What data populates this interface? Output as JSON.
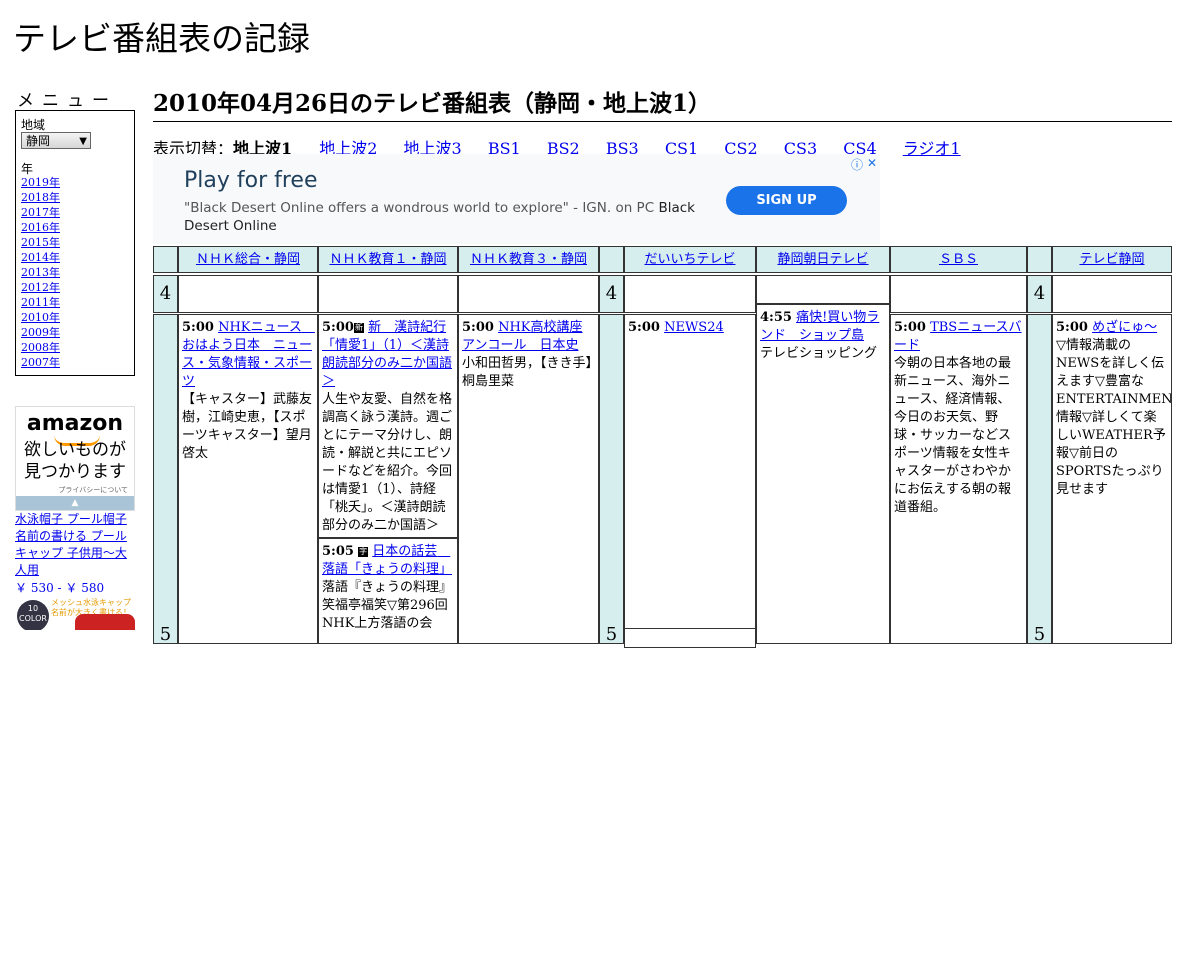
{
  "site_title": "テレビ番組表の記録",
  "menu": {
    "heading": "メニュー",
    "region_label": "地域",
    "region_value": "静岡",
    "year_label": "年",
    "years": [
      "2019年",
      "2018年",
      "2017年",
      "2016年",
      "2015年",
      "2014年",
      "2013年",
      "2012年",
      "2011年",
      "2010年",
      "2009年",
      "2008年",
      "2007年"
    ]
  },
  "amazon_ad": {
    "logo": "amazon",
    "copy_line1": "欲しいものが",
    "copy_line2": "見つかります",
    "privacy": "プライバシーについて"
  },
  "product": {
    "name": "水泳帽子 プール帽子 名前の書ける プールキャップ 子供用～大人用",
    "price": "￥ 530 - ￥ 580",
    "badge": "10 COLOR",
    "tagline": "メッシュ水泳キャップ 名前が大きく書ける！"
  },
  "page_heading": "2010年04月26日のテレビ番組表（静岡・地上波1）",
  "switcher": {
    "label": "表示切替：",
    "current": "地上波1",
    "links": [
      "地上波2",
      "地上波3",
      "BS1",
      "BS2",
      "BS3",
      "CS1",
      "CS2",
      "CS3",
      "CS4",
      "ラジオ1"
    ]
  },
  "ad_banner": {
    "headline": "Play for free",
    "description": "\"Black Desert Online offers a wondrous world to explore\" - IGN. on PC",
    "advertiser": "Black Desert Online",
    "button": "SIGN UP"
  },
  "schedule": {
    "channels": [
      "ＮＨＫ総合・静岡",
      "ＮＨＫ教育１・静岡",
      "ＮＨＫ教育３・静岡",
      "だいいちテレビ",
      "静岡朝日テレビ",
      "ＳＢＳ",
      "テレビ静岡"
    ],
    "hours": [
      "4",
      "5"
    ],
    "programs": {
      "nhk_sogo": {
        "time": "5:00",
        "title": "NHKニュース　おはよう日本　ニュース・気象情報・スポーツ",
        "desc": "【キャスター】武藤友樹，江崎史恵，【スポーツキャスター】望月啓太"
      },
      "nhk_edu1_a": {
        "time": "5:00",
        "mark": "新",
        "title": "新　漢詩紀行「情愛1」（1）＜漢詩朗読部分のみ二か国語＞",
        "desc": "人生や友愛、自然を格調高く詠う漢詩。週ごとにテーマ分けし、朗読・解説と共にエピソードなどを紹介。今回は情愛1（1）、詩経「桃夭」。＜漢詩朗読部分のみ二か国語＞"
      },
      "nhk_edu1_b": {
        "time": "5:05",
        "mark": "字",
        "title": "日本の話芸　落語「きょうの料理」",
        "desc": "落語『きょうの料理』笑福亭福笑▽第296回NHK上方落語の会"
      },
      "nhk_edu3": {
        "time": "5:00",
        "title": "NHK高校講座アンコール　日本史",
        "desc": "小和田哲男，【きき手】桐島里菜"
      },
      "daiichi": {
        "time": "5:00",
        "title": "NEWS24",
        "desc": ""
      },
      "asahi": {
        "time": "4:55",
        "title": "痛快!買い物ランド　ショップ島",
        "desc": "テレビショッピング"
      },
      "sbs": {
        "time": "5:00",
        "title": "TBSニュースバード",
        "desc": "今朝の日本各地の最新ニュース、海外ニュース、経済情報、今日のお天気、野球・サッカーなどスポーツ情報を女性キャスターがさわやかにお伝えする朝の報道番組。"
      },
      "tvshizuoka": {
        "time": "5:00",
        "title": "めざにゅ～",
        "desc": "▽情報満載のNEWSを詳しく伝えます▽豊富なENTERTAINMENT情報▽詳しくて楽しいWEATHER予報▽前日のSPORTSたっぷり見せます"
      }
    }
  }
}
